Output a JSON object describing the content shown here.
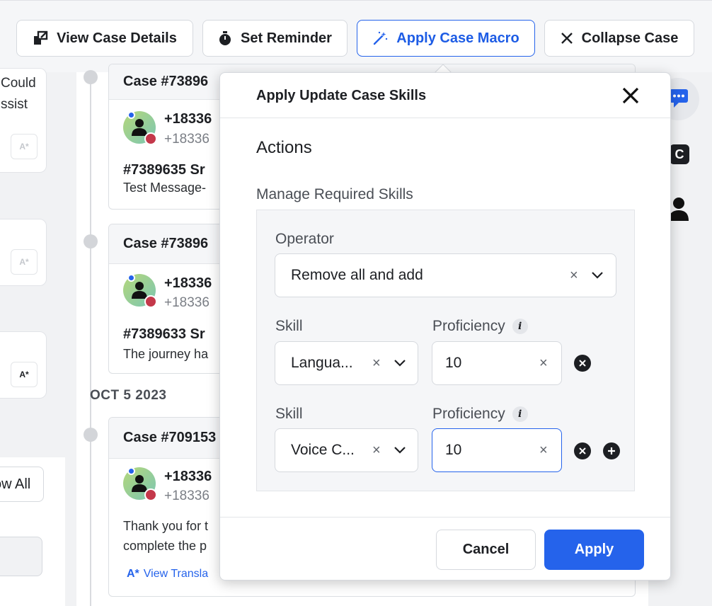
{
  "toolbar": {
    "view_case_details": "View Case Details",
    "set_reminder": "Set Reminder",
    "apply_case_macro": "Apply Case Macro",
    "collapse_case": "Collapse Case"
  },
  "left_panel": {
    "snippet_line1": "Could",
    "snippet_line2": "ssist",
    "show_all": "ow All",
    "translate_icon_text": "A*"
  },
  "timeline": {
    "date_header": "OCT 5 2023",
    "cases": [
      {
        "header": "Case #73896",
        "phone": "+18336",
        "phone_sub": "+18336",
        "title": "#7389635 Sr",
        "message": "Test Message-"
      },
      {
        "header": "Case #73896",
        "phone": "+18336",
        "phone_sub": "+18336",
        "title": "#7389633 Sr",
        "message": "The journey ha"
      },
      {
        "header": "Case #709153",
        "phone": "+18336",
        "phone_sub": "+18336",
        "message_line1": "Thank you for t",
        "message_line2": "complete the p",
        "view_translation": "View Transla"
      }
    ]
  },
  "right_rail": {
    "badge_letter": "C"
  },
  "modal": {
    "title": "Apply Update Case Skills",
    "section_title": "Actions",
    "subsection_title": "Manage Required Skills",
    "operator_label": "Operator",
    "operator_value": "Remove all and add",
    "skill_rows": [
      {
        "skill_label": "Skill",
        "skill_value": "Langua...",
        "proficiency_label": "Proficiency",
        "proficiency_value": "10"
      },
      {
        "skill_label": "Skill",
        "skill_value": "Voice C...",
        "proficiency_label": "Proficiency",
        "proficiency_value": "10"
      }
    ],
    "info_glyph": "i",
    "clear_glyph": "×",
    "cancel_label": "Cancel",
    "apply_label": "Apply"
  },
  "colors": {
    "accent": "#2563eb",
    "text": "#1d1f23",
    "muted": "#4a4e55"
  }
}
